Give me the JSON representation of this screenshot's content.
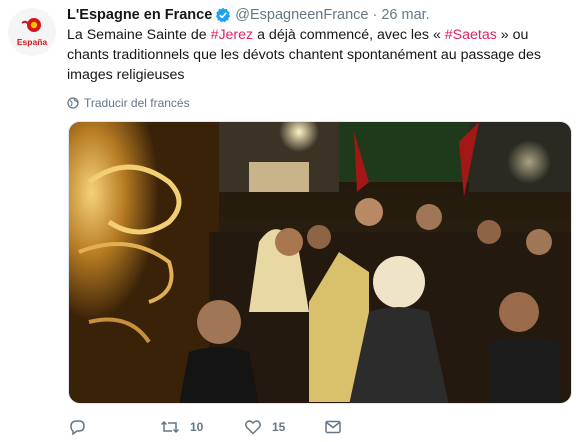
{
  "author": {
    "name": "L'Espagne en France",
    "handle": "@EspagneenFrance",
    "separator": "·",
    "date": "26 mar.",
    "avatar_text": "España"
  },
  "tweet": {
    "text_before_1": "La Semaine Sainte de ",
    "hashtag_1": "#Jerez",
    "text_between": " a déjà commencé, avec les « ",
    "hashtag_2": "#Saetas",
    "text_after": " » ou chants traditionnels que les dévots chantent spontanément au passage des images religieuses"
  },
  "translate_label": "Traducir del francés",
  "actions": {
    "reply_count": "",
    "retweet_count": "10",
    "like_count": "15"
  },
  "icons": {
    "verified": "verified-badge-icon",
    "globe": "globe-icon",
    "reply": "reply-icon",
    "retweet": "retweet-icon",
    "like": "heart-icon",
    "dm": "envelope-icon",
    "caret": "chevron-down-icon"
  },
  "colors": {
    "hashtag": "#e0245e",
    "verified": "#1da1f2",
    "muted": "#657786"
  }
}
